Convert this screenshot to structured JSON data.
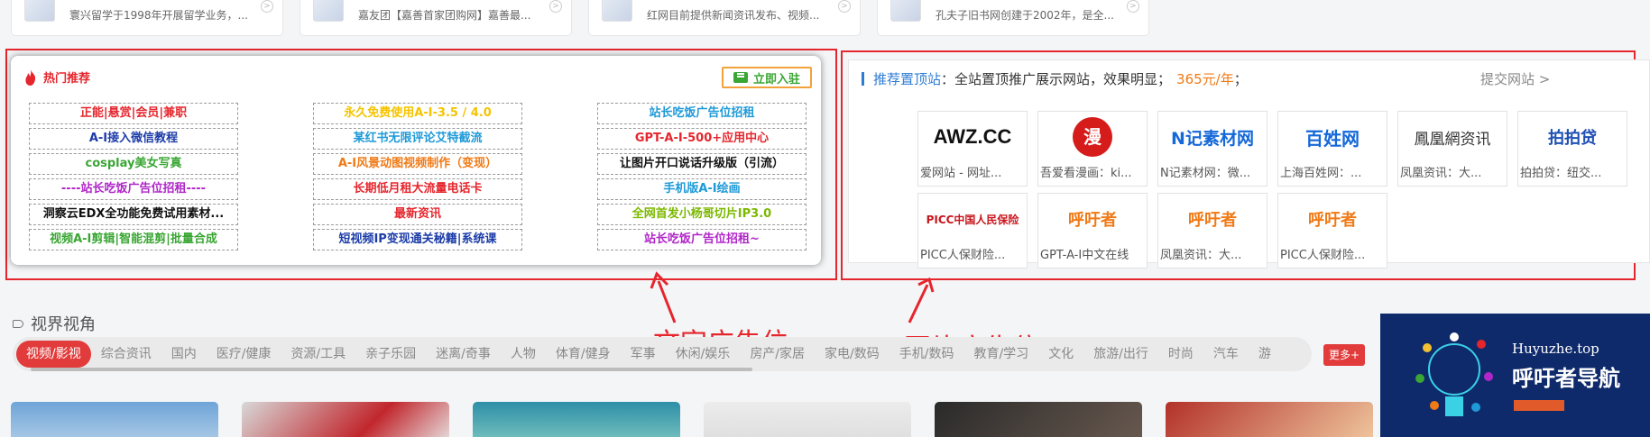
{
  "top_cards": [
    {
      "desc": "寰兴留学于1998年开展留学业务，..."
    },
    {
      "desc": "嘉友团【嘉善首家团购网】嘉善最..."
    },
    {
      "desc": "红网目前提供新闻资讯发布、视频..."
    },
    {
      "desc": "孔夫子旧书网创建于2002年，是全..."
    }
  ],
  "hot": {
    "title": "热门推荐",
    "join_label": "立即入驻",
    "links": [
      {
        "text": "正能|悬赏|会员|兼职",
        "color": "#e5262d"
      },
      {
        "text": "永久免费使用A-I-3.5 / 4.0",
        "color": "#f5c400"
      },
      {
        "text": "站长吃饭广告位招租",
        "color": "#1e9ad8"
      },
      {
        "text": "A-I接入微信教程",
        "color": "#1c3ca8"
      },
      {
        "text": "某红书无限评论艾特截流",
        "color": "#1e9ad8"
      },
      {
        "text": "GPT-A-I-500+应用中心",
        "color": "#e5262d"
      },
      {
        "text": "cosplay美女写真",
        "color": "#3aa634"
      },
      {
        "text": "A-I风景动图视频制作（变现）",
        "color": "#f07a16"
      },
      {
        "text": "让图片开口说话升级版（引流）",
        "color": "#111111"
      },
      {
        "text": "----站长吃饭广告位招租----",
        "color": "#b026c8"
      },
      {
        "text": "长期低月租大流量电话卡",
        "color": "#e5262d"
      },
      {
        "text": "手机版A-I绘画",
        "color": "#1e9ad8"
      },
      {
        "text": "洞察云EDX全功能免费试用素材...",
        "color": "#111111"
      },
      {
        "text": "最新资讯",
        "color": "#e5262d"
      },
      {
        "text": "全网首发小杨哥切片IP3.0",
        "color": "#7cb800"
      },
      {
        "text": "视频A-I剪辑|智能混剪|批量合成",
        "color": "#3aa634"
      },
      {
        "text": "短视频IP变现通关秘籍|系统课",
        "color": "#1c3ca8"
      },
      {
        "text": "站长吃饭广告位招租~",
        "color": "#b026c8"
      }
    ]
  },
  "recommend": {
    "title": "推荐置顶站",
    "desc": "：全站置顶推广展示网站，效果明显；",
    "price": "365元/年",
    "tail": "；",
    "submit": "提交网站 >"
  },
  "logos": [
    {
      "logo": "AWZ.CC",
      "caption": "爱网站 - 网址..."
    },
    {
      "logo": "漫",
      "caption": "吾爱看漫画：ki..."
    },
    {
      "logo": "N记素材网",
      "caption": "N记素材网：微..."
    },
    {
      "logo": "百姓网",
      "caption": "上海百姓网：..."
    },
    {
      "logo": "鳳凰網资讯",
      "caption": "凤凰资讯：大..."
    },
    {
      "logo": "拍拍贷",
      "caption": "拍拍贷：纽交..."
    },
    {
      "logo": "PICC中国人民保险",
      "caption": "PICC人保财险..."
    },
    {
      "logo": "呼吁者",
      "caption": "GPT-A-I中文在线"
    },
    {
      "logo": "呼吁者",
      "caption": "凤凰资讯：大..."
    },
    {
      "logo": "呼吁者",
      "caption": "PICC人保财险..."
    }
  ],
  "annotations": {
    "text_ad": "文字广告位",
    "image_ad": "图片广告位"
  },
  "section": {
    "title": "视界视角",
    "tabs": [
      "视频/影视",
      "综合资讯",
      "国内",
      "医疗/健康",
      "资源/工具",
      "亲子乐园",
      "迷离/奇事",
      "人物",
      "体育/健身",
      "军事",
      "休闲/娱乐",
      "房产/家居",
      "家电/数码",
      "手机/数码",
      "教育/学习",
      "文化",
      "旅游/出行",
      "时尚",
      "汽车",
      "游"
    ],
    "more": "更多+"
  },
  "banner": {
    "site": "Huyuzhe.top",
    "name": "呼吁者导航"
  },
  "colors": {
    "accent_red": "#e5262d",
    "link_blue": "#2e7bd6",
    "price_orange": "#f07a16"
  }
}
